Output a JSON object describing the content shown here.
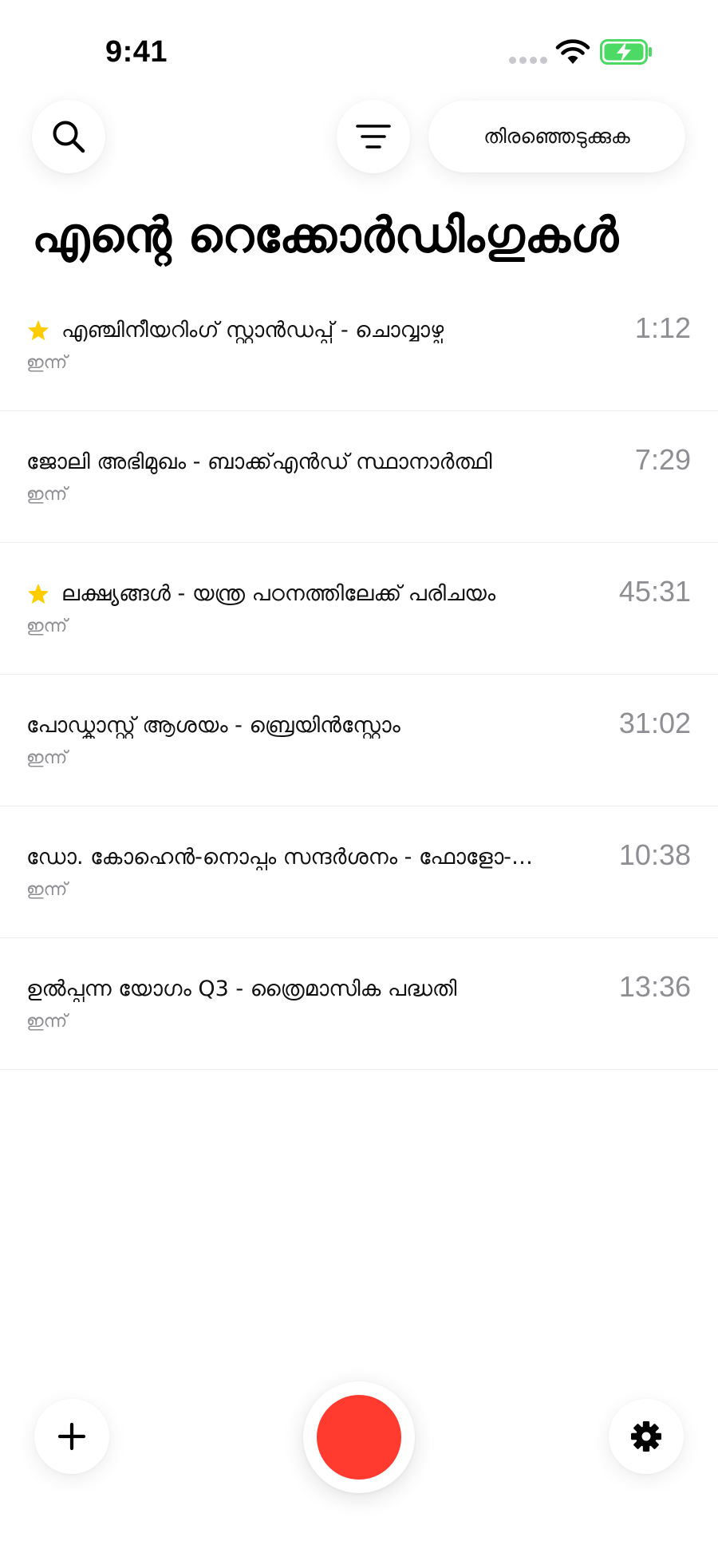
{
  "status_bar": {
    "time": "9:41",
    "battery_color": "#4cd964"
  },
  "header": {
    "search_icon": "search-icon",
    "filter_icon": "filter-icon",
    "select_label": "തിരഞ്ഞെടുക്കുക",
    "title": "എന്റെ റെക്കോർഡിംഗുകൾ"
  },
  "recordings": [
    {
      "title": "എഞ്ചിനീയറിംഗ് സ്റ്റാൻഡപ്പ് - ചൊവ്വാഴ്ച",
      "date": "ഇന്ന്",
      "duration": "1:12",
      "starred": true
    },
    {
      "title": "ജോലി അഭിമുഖം - ബാക്ക്എൻഡ് സ്ഥാനാർത്ഥി",
      "date": "ഇന്ന്",
      "duration": "7:29",
      "starred": false
    },
    {
      "title": "ലക്ഷ്യങ്ങൾ - യന്ത്ര പഠനത്തിലേക്ക് പരിചയം",
      "date": "ഇന്ന്",
      "duration": "45:31",
      "starred": true
    },
    {
      "title": "പോഡ്കാസ്റ്റ് ആശയം - ബ്രെയിൻസ്റ്റോം",
      "date": "ഇന്ന്",
      "duration": "31:02",
      "starred": false
    },
    {
      "title": "ഡോ. കോഹെൻ-നൊപ്പം സന്ദർശനം - ഫോളോ-…",
      "date": "ഇന്ന്",
      "duration": "10:38",
      "starred": false
    },
    {
      "title": "ഉൽപ്പന്ന യോഗം Q3 - ത്രൈമാസിക പദ്ധതി",
      "date": "ഇന്ന്",
      "duration": "13:36",
      "starred": false
    }
  ],
  "colors": {
    "record": "#ff3b30",
    "star": "#ffcc00",
    "secondary_text": "#8e8e93"
  },
  "bottom_bar": {
    "add_icon": "plus-icon",
    "record_icon": "record-icon",
    "settings_icon": "gear-icon"
  }
}
